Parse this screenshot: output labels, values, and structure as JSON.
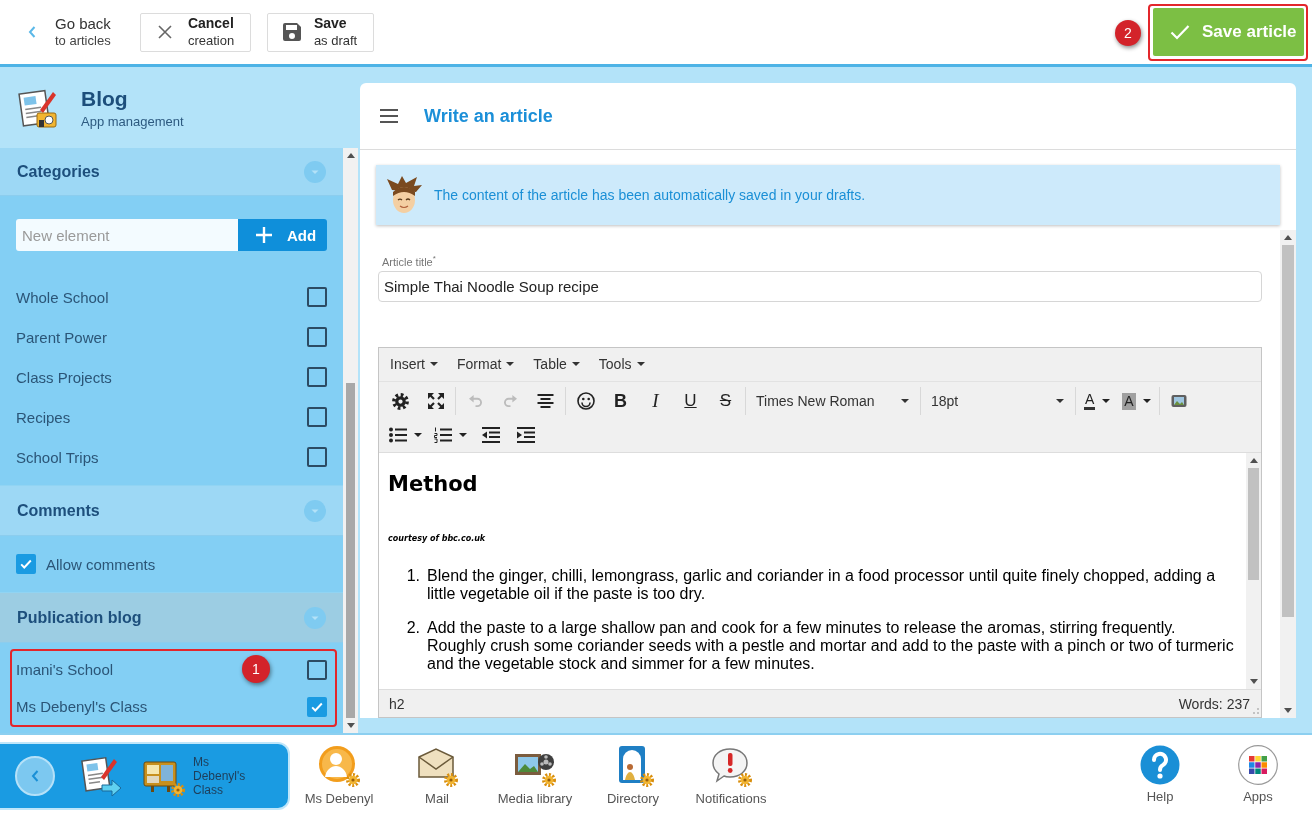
{
  "top_bar": {
    "back": {
      "title": "Go back",
      "subtitle": "to articles"
    },
    "cancel": {
      "title": "Cancel",
      "subtitle": "creation"
    },
    "save_draft": {
      "title": "Save",
      "subtitle": "as draft"
    },
    "save_article": {
      "label": "Save article",
      "callout": "2"
    }
  },
  "app": {
    "title": "Blog",
    "subtitle": "App management"
  },
  "sidebar": [
    {
      "kind": "categories",
      "title": "Categories",
      "highlighted": false,
      "new_element": {
        "placeholder": "New element"
      },
      "add_button": "Add",
      "items": [
        {
          "label": "Whole School",
          "checked": false
        },
        {
          "label": "Parent Power",
          "checked": false
        },
        {
          "label": "Class Projects",
          "checked": false
        },
        {
          "label": "Recipes",
          "checked": false
        },
        {
          "label": "School Trips",
          "checked": false
        }
      ]
    },
    {
      "kind": "toggles",
      "title": "Comments",
      "highlighted": false,
      "items": [
        {
          "label": "Allow comments",
          "checked": true
        }
      ]
    },
    {
      "kind": "checklist",
      "title": "Publication blog",
      "highlighted": true,
      "callout": "1",
      "items": [
        {
          "label": "Imani's School",
          "checked": false
        },
        {
          "label": "Ms Debenyl's Class",
          "checked": true
        }
      ]
    }
  ],
  "article": {
    "heading": "Write an article",
    "notice": "The content of the article has been automatically saved in your drafts.",
    "title_field": {
      "label": "Article title$^{*}$",
      "value": "Simple Thai Noodle Soup recipe"
    },
    "editor": {
      "menus": [
        {
          "label": "Insert"
        },
        {
          "label": "Format"
        },
        {
          "label": "Table"
        },
        {
          "label": "Tools"
        }
      ],
      "toolbar": [
        [
          [
            {
              "kind": "settings",
              "disabled": false
            },
            {
              "kind": "fullscreen",
              "disabled": false
            }
          ],
          [
            {
              "kind": "undo",
              "disabled": true
            },
            {
              "kind": "redo",
              "disabled": true
            },
            {
              "kind": "align",
              "disabled": false
            }
          ],
          [
            {
              "kind": "emoji",
              "disabled": false
            },
            {
              "kind": "bold",
              "glyph": "B",
              "disabled": false
            },
            {
              "kind": "italic",
              "glyph": "I",
              "disabled": false
            },
            {
              "kind": "underline",
              "glyph": "U",
              "disabled": false
            },
            {
              "kind": "strikethrough",
              "glyph": "S",
              "disabled": false
            }
          ],
          [
            {
              "kind": "fontfamily",
              "value": "Times New Roman",
              "disabled": false
            }
          ],
          [
            {
              "kind": "fontsize",
              "value": "18pt",
              "disabled": false
            }
          ],
          [
            {
              "kind": "forecolor",
              "glyph": "A",
              "disabled": false
            },
            {
              "kind": "backcolor",
              "glyph": "A",
              "disabled": false
            }
          ],
          [
            {
              "kind": "image",
              "disabled": false
            }
          ]
        ],
        [
          [
            {
              "kind": "bullist",
              "disabled": false
            },
            {
              "kind": "numlist",
              "disabled": false
            },
            {
              "kind": "outdent",
              "disabled": false
            },
            {
              "kind": "indent",
              "disabled": false
            }
          ]
        ]
      ],
      "content": [
        {
          "kind": "heading",
          "text": "Method"
        },
        {
          "kind": "credit",
          "text": "courtesy of bbc.co.uk"
        },
        {
          "kind": "list",
          "items": [
            {
              "number": "1.",
              "text": "Blend the ginger, chilli, lemongrass, garlic and coriander in a food processor until quite finely chopped, adding a little vegetable oil if the paste is too dry."
            },
            {
              "number": "2.",
              "text": "Add the paste to a large shallow pan and cook for a few minutes to release the aromas, stirring frequently. Roughly crush some coriander seeds with a pestle and mortar and add to the paste with a pinch or two of turmeric and the vegetable stock and simmer for a few minutes."
            }
          ]
        }
      ],
      "status": {
        "path": "h2",
        "word_count": "Words: 237"
      }
    }
  },
  "dock": {
    "current": {
      "label": "Ms Debenyl's Class"
    },
    "apps": [
      {
        "kind": "profile",
        "label": "Ms Debenyl"
      },
      {
        "kind": "mail",
        "label": "Mail"
      },
      {
        "kind": "media",
        "label": "Media library"
      },
      {
        "kind": "directory",
        "label": "Directory"
      },
      {
        "kind": "notifications",
        "label": "Notifications"
      }
    ],
    "utilities": [
      {
        "kind": "help",
        "label": "Help"
      },
      {
        "kind": "apps",
        "label": "Apps"
      }
    ]
  }
}
